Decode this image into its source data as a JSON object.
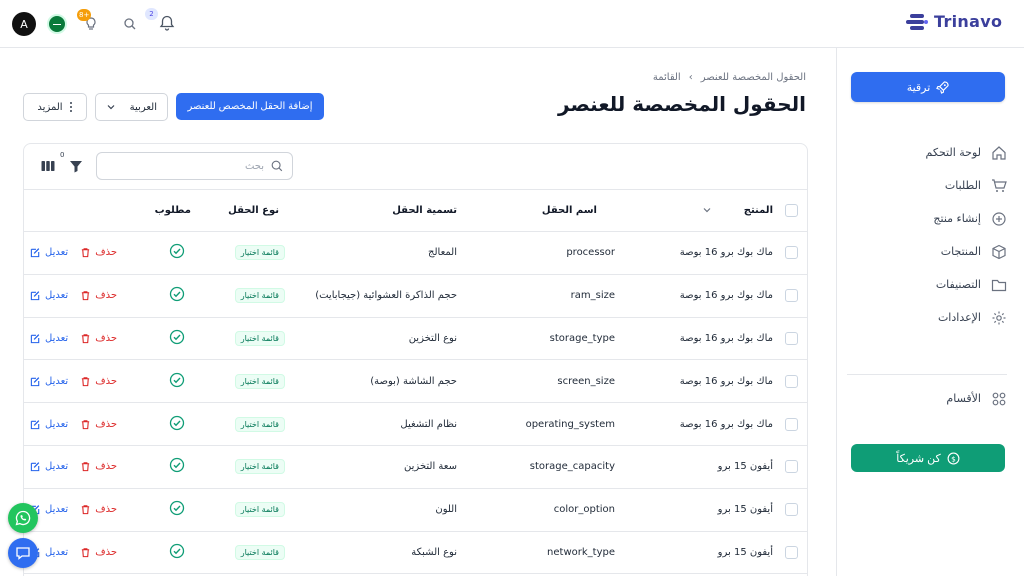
{
  "brand": {
    "name": "Trinavo"
  },
  "topbar": {
    "avatar_letter": "A",
    "bulb_badge": "+8",
    "notifications_count": "2"
  },
  "sidebar": {
    "upgrade_label": "ترقية",
    "items": [
      {
        "label": "لوحة التحكم",
        "icon": "home-icon"
      },
      {
        "label": "الطلبات",
        "icon": "cart-icon"
      },
      {
        "label": "إنشاء منتج",
        "icon": "plus-circle-icon"
      },
      {
        "label": "المنتجات",
        "icon": "box-icon"
      },
      {
        "label": "التصنيفات",
        "icon": "folder-icon"
      },
      {
        "label": "الإعدادات",
        "icon": "gear-icon"
      }
    ],
    "sections_label": "الأقسام",
    "partner_label": "كن شريكاً"
  },
  "header": {
    "breadcrumb": [
      "القائمة",
      "الحقول المخصصة للعنصر"
    ],
    "title": "الحقول المخصصة للعنصر",
    "add_button": "إضافة الحقل المخصص للعنصر",
    "language": "العربية",
    "more": "المزيد"
  },
  "toolbar": {
    "search_placeholder": "بحث",
    "filter_count": "0"
  },
  "table": {
    "columns": [
      "المنتج",
      "اسم الحقل",
      "تسمية الحقل",
      "نوع الحقل",
      "مطلوب"
    ],
    "edit_label": "تعديل",
    "delete_label": "حذف",
    "rows": [
      {
        "product": "ماك بوك برو 16 بوصة",
        "field_name": "processor",
        "field_label": "المعالج",
        "field_type": "قائمة اختيار"
      },
      {
        "product": "ماك بوك برو 16 بوصة",
        "field_name": "ram_size",
        "field_label": "حجم الذاكرة العشوائية (جيجابايت)",
        "field_type": "قائمة اختيار"
      },
      {
        "product": "ماك بوك برو 16 بوصة",
        "field_name": "storage_type",
        "field_label": "نوع التخزين",
        "field_type": "قائمة اختيار"
      },
      {
        "product": "ماك بوك برو 16 بوصة",
        "field_name": "screen_size",
        "field_label": "حجم الشاشة (بوصة)",
        "field_type": "قائمة اختيار"
      },
      {
        "product": "ماك بوك برو 16 بوصة",
        "field_name": "operating_system",
        "field_label": "نظام التشغيل",
        "field_type": "قائمة اختيار"
      },
      {
        "product": "أيفون 15 برو",
        "field_name": "storage_capacity",
        "field_label": "سعة التخزين",
        "field_type": "قائمة اختيار"
      },
      {
        "product": "أيفون 15 برو",
        "field_name": "color_option",
        "field_label": "اللون",
        "field_type": "قائمة اختيار"
      },
      {
        "product": "أيفون 15 برو",
        "field_name": "network_type",
        "field_label": "نوع الشبكة",
        "field_type": "قائمة اختيار"
      }
    ]
  },
  "colors": {
    "primary": "#2f6df0",
    "success": "#0f9d76",
    "danger": "#dc2626",
    "brand": "#3b3f9c"
  }
}
